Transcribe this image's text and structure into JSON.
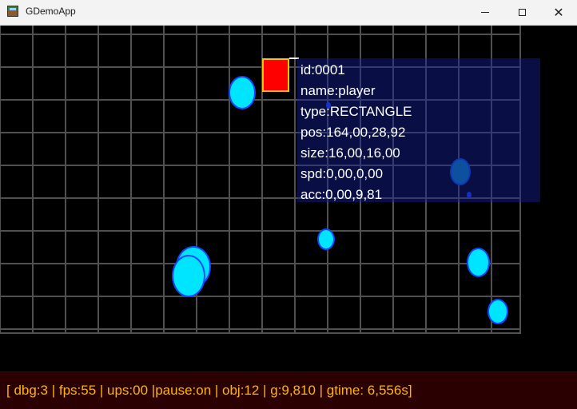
{
  "window": {
    "title": "GDemoApp",
    "icons": {
      "app": "game-window-icon",
      "minimize": "minimize-icon",
      "maximize": "maximize-icon",
      "close": "close-icon"
    },
    "close_glyph": "✕"
  },
  "scene": {
    "background_color": "#000000",
    "grid_color": "#505050",
    "ball_color": "#00e5ff",
    "ball_border_color": "#1546ff",
    "player_color": "#ff0000",
    "player_border_color": "#ffc200"
  },
  "info_panel": {
    "lines": [
      "id:0001",
      "name:player",
      "type:RECTANGLE",
      "pos:164,00,28,92",
      "size:16,00,16,00",
      "spd:0,00,0,00",
      "acc:0,00,9,81"
    ]
  },
  "status_bar": {
    "text": "[ dbg:3 | fps:55 | ups:00 |pause:on | obj:12 | g:9,810 | gtime: 6,556s]",
    "color": "#ffb400",
    "background": "#2a0000"
  }
}
